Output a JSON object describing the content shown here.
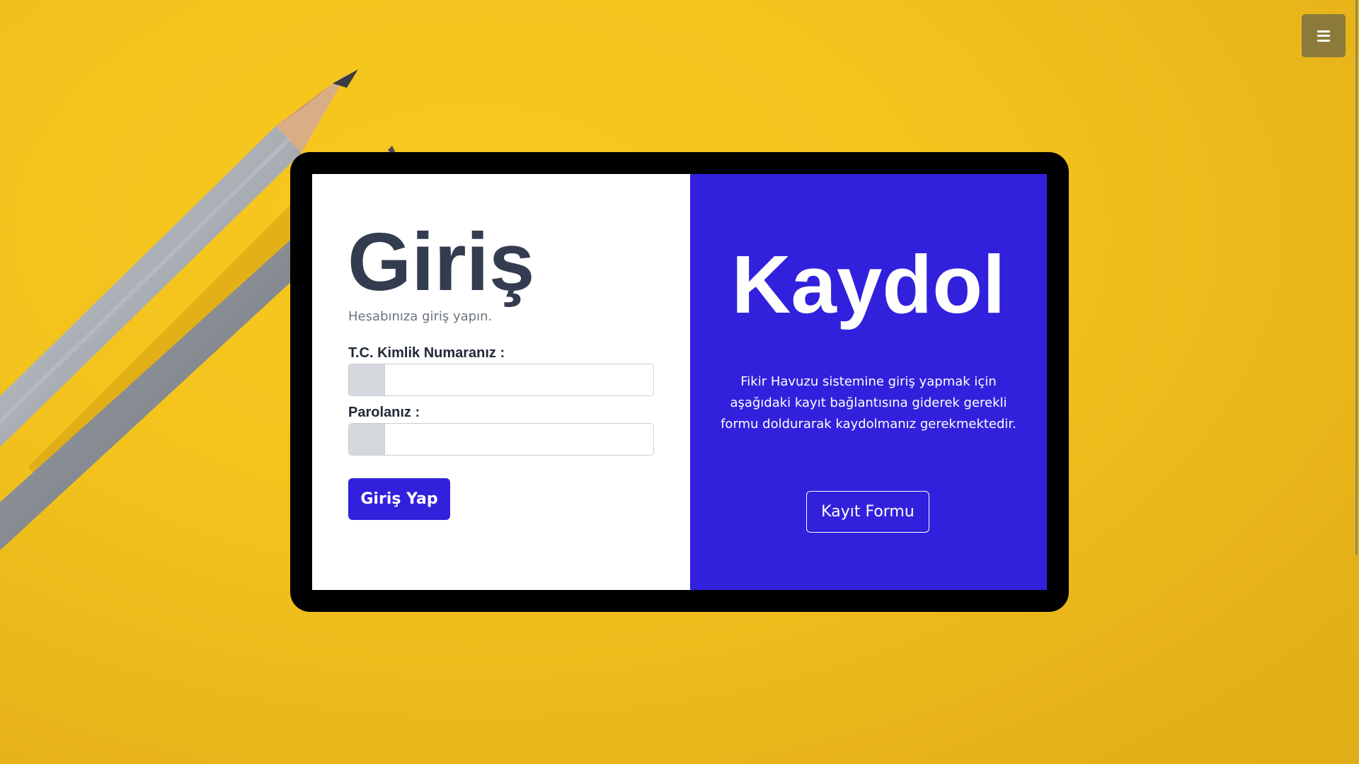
{
  "menu": {
    "icon": "hamburger-icon"
  },
  "login": {
    "title": "Giriş",
    "subtitle": "Hesabınıza giriş yapın.",
    "tc_label": "T.C. Kimlik Numaranız :",
    "tc_value": "",
    "password_label": "Parolanız :",
    "password_value": "",
    "submit_label": "Giriş Yap"
  },
  "signup": {
    "title": "Kaydol",
    "description": "Fikir Havuzu sistemine giriş yapmak için aşağıdaki kayıt bağlantısına giderek gerekli formu doldurarak kaydolmanız gerekmektedir.",
    "button_label": "Kayıt Formu"
  },
  "colors": {
    "background": "#f3c31d",
    "accent": "#3121dc",
    "device_frame": "#000000",
    "title_text": "#333d4f",
    "menu_button": "#8c7a3a"
  }
}
